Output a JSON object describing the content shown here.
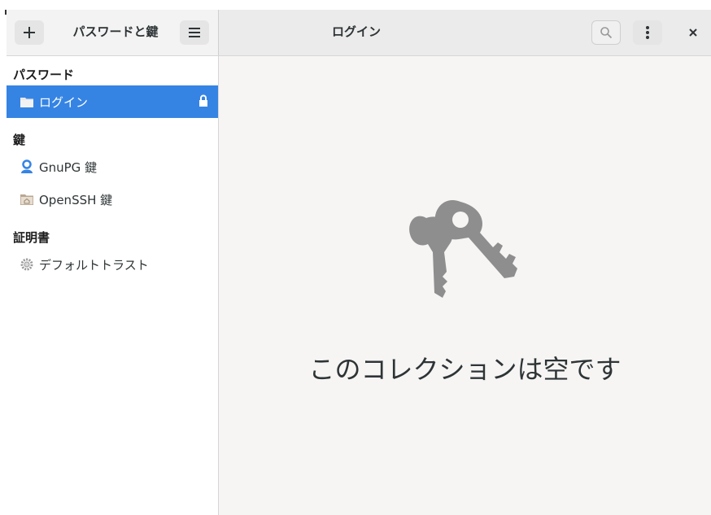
{
  "header": {
    "app_title": "パスワードと鍵",
    "view_title": "ログイン"
  },
  "icons": {
    "add": "plus-icon",
    "menu": "hamburger-icon",
    "search": "search-icon",
    "more": "kebab-icon",
    "close": "close-icon"
  },
  "sidebar": {
    "sections": [
      {
        "title": "パスワード",
        "items": [
          {
            "label": "ログイン",
            "icon": "folder-icon",
            "selected": true,
            "locked_icon": "lock-icon"
          }
        ]
      },
      {
        "title": "鍵",
        "items": [
          {
            "label": "GnuPG 鍵",
            "icon": "person-key-icon"
          },
          {
            "label": "OpenSSH 鍵",
            "icon": "home-folder-icon"
          }
        ]
      },
      {
        "title": "証明書",
        "items": [
          {
            "label": "デフォルトトラスト",
            "icon": "gear-icon"
          }
        ]
      }
    ]
  },
  "main": {
    "empty_message": "このコレクションは空です",
    "empty_icon": "keys-icon"
  },
  "colors": {
    "accent": "#3584e4",
    "key_icon": "#8e8e8e"
  }
}
